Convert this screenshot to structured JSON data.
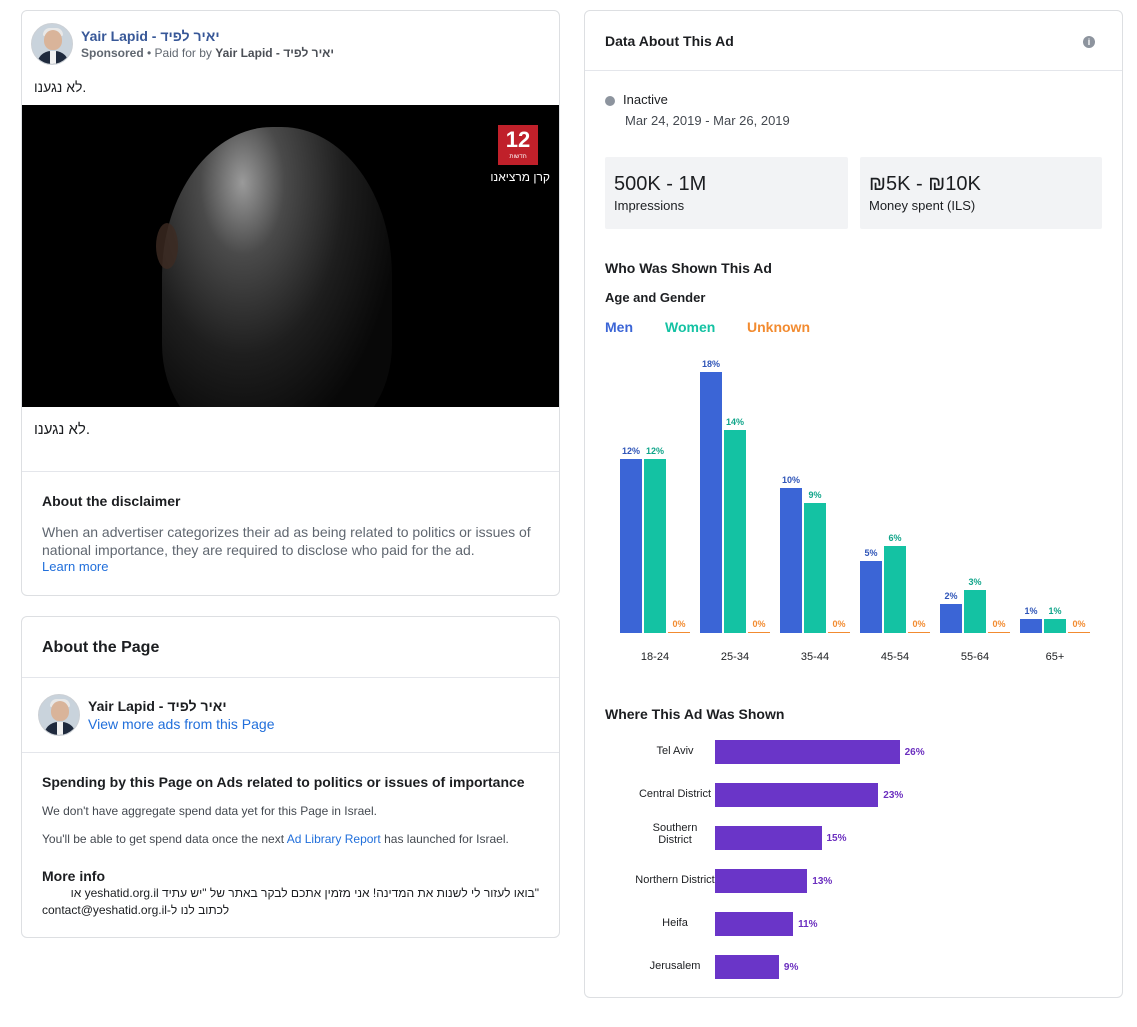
{
  "ad": {
    "page_name": "Yair Lapid - יאיר לפיד",
    "sponsored": "Sponsored",
    "paid_for_prefix": " • Paid for by ",
    "paid_for_name": "Yair Lapid - יאיר לפיד",
    "body_text": "לא נגענו.",
    "caption": "לא נגענו.",
    "video_channel_number": "12",
    "video_channel_brand": "חדשות",
    "video_channel_name": "קרן מרציאנו"
  },
  "disclaimer": {
    "title": "About the disclaimer",
    "text": "When an advertiser categorizes their ad as being related to politics or issues of national importance, they are required to disclose who paid for the ad.",
    "learn_more": "Learn more"
  },
  "about_page": {
    "title": "About the Page",
    "page_name": "Yair Lapid - יאיר לפיד",
    "view_more": "View more ads from this Page",
    "spending_title": "Spending by this Page on Ads related to politics or issues of importance",
    "spending_line1": "We don't have aggregate spend data yet for this Page in Israel.",
    "spending_line2_prefix": "You'll be able to get spend data once the next ",
    "spending_line2_link": "Ad Library Report",
    "spending_line2_suffix": " has launched for Israel.",
    "more_info_title": "More info",
    "more_info_line1": "\"בואו לעזור לי לשנות את המדינה! אני מזמין אתכם לבקר באתר של \"יש עתיד yeshatid.org.il או",
    "more_info_line2": "לכתוב לנו ל-contact@yeshatid.org.il"
  },
  "data_panel": {
    "title": "Data About This Ad",
    "info_icon": "info-icon",
    "status": "Inactive",
    "date_range": "Mar 24, 2019 - Mar 26, 2019",
    "impressions_value": "500K - 1M",
    "impressions_label": "Impressions",
    "spent_value": "₪5K - ₪10K",
    "spent_label": "Money spent (ILS)",
    "who_title": "Who Was Shown This Ad",
    "age_gender_title": "Age and Gender",
    "where_title": "Where This Ad Was Shown"
  },
  "colors": {
    "men": "#3b65d6",
    "women": "#14c2a3",
    "unknown": "#f28b30",
    "location": "#6a35c8",
    "link": "#216fdb"
  },
  "chart_data": [
    {
      "type": "bar",
      "title": "Age and Gender",
      "legend": "top-left",
      "categories": [
        "18-24",
        "25-34",
        "35-44",
        "45-54",
        "55-64",
        "65+"
      ],
      "series": [
        {
          "name": "Men",
          "values": [
            12,
            18,
            10,
            5,
            2,
            1
          ]
        },
        {
          "name": "Women",
          "values": [
            12,
            14,
            9,
            6,
            3,
            1
          ]
        },
        {
          "name": "Unknown",
          "values": [
            0,
            0,
            0,
            0,
            0,
            0
          ]
        }
      ],
      "value_suffix": "%",
      "ylim": [
        0,
        18
      ]
    },
    {
      "type": "bar",
      "orientation": "horizontal",
      "title": "Where This Ad Was Shown",
      "categories": [
        "Tel Aviv",
        "Central District",
        "Southern District",
        "Northern District",
        "Heifa",
        "Jerusalem"
      ],
      "values": [
        26,
        23,
        15,
        13,
        11,
        9
      ],
      "value_suffix": "%"
    }
  ]
}
